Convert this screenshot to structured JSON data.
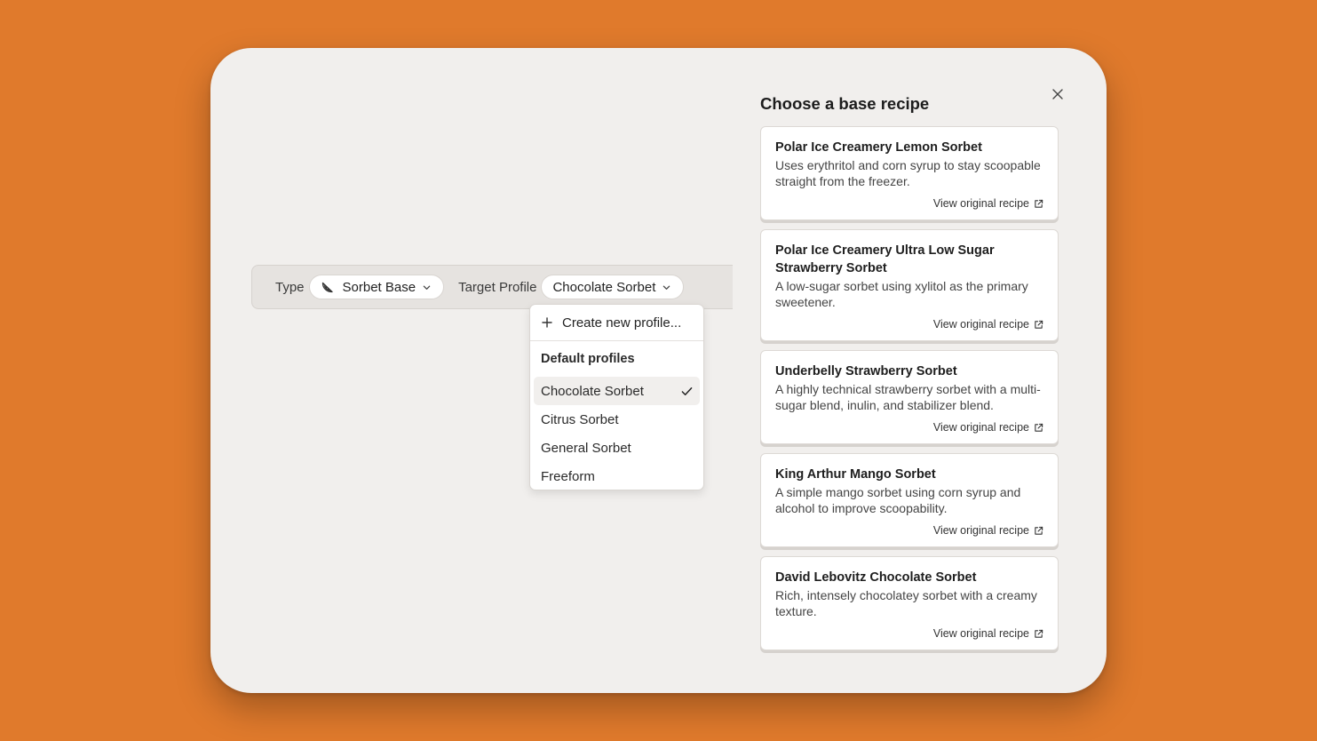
{
  "toolbar": {
    "type_label": "Type",
    "type_value": "Sorbet Base",
    "type_icon": "melon-slice-icon",
    "profile_label": "Target Profile",
    "profile_value": "Chocolate Sorbet"
  },
  "dropdown": {
    "create_label": "Create new profile...",
    "heading": "Default profiles",
    "items": [
      {
        "label": "Chocolate Sorbet",
        "selected": true
      },
      {
        "label": "Citrus Sorbet",
        "selected": false
      },
      {
        "label": "General Sorbet",
        "selected": false
      },
      {
        "label": "Freeform",
        "selected": false
      }
    ]
  },
  "panel": {
    "title": "Choose a base recipe",
    "link_label": "View original recipe",
    "recipes": [
      {
        "title": "Polar Ice Creamery Lemon Sorbet",
        "description": "Uses erythritol and corn syrup to stay scoopable straight from the freezer."
      },
      {
        "title": "Polar Ice Creamery Ultra Low Sugar Strawberry Sorbet",
        "description": "A low-sugar sorbet using xylitol as the primary sweetener."
      },
      {
        "title": "Underbelly Strawberry Sorbet",
        "description": "A highly technical strawberry sorbet with a multi-sugar blend, inulin, and stabilizer blend."
      },
      {
        "title": "King Arthur Mango Sorbet",
        "description": "A simple mango sorbet using corn syrup and alcohol to improve scoopability."
      },
      {
        "title": "David Lebovitz Chocolate Sorbet",
        "description": "Rich, intensely chocolatey sorbet with a creamy texture."
      }
    ]
  },
  "colors": {
    "background": "#E07A2C",
    "window": "#F1EFED",
    "toolbar": "#E6E3E0",
    "card": "#FFFFFF"
  }
}
